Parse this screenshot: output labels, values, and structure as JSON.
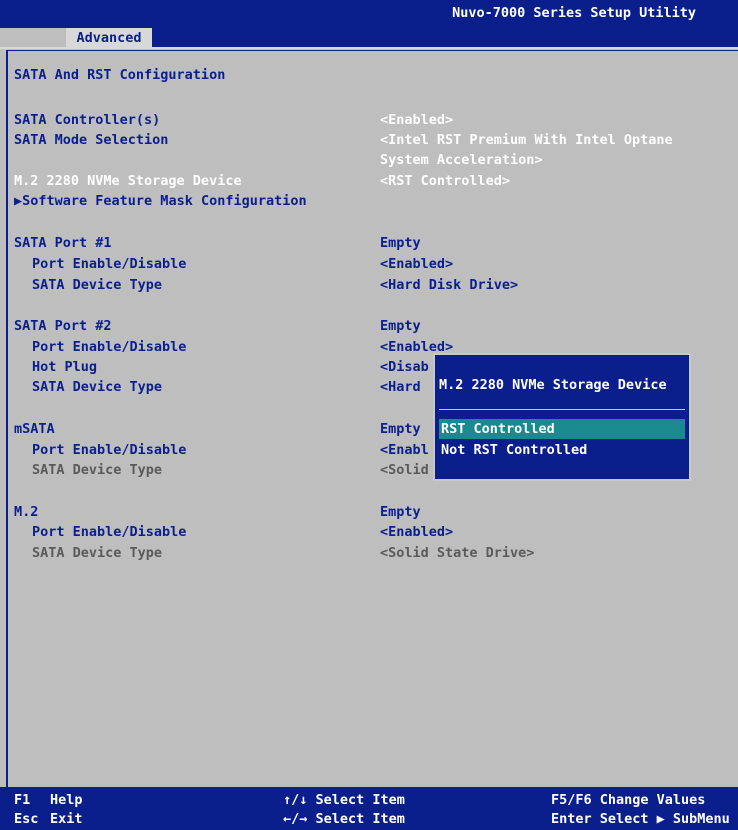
{
  "header": {
    "title": "Nuvo-7000 Series Setup Utility",
    "tab": "Advanced"
  },
  "section_title": "SATA And RST Configuration",
  "settings": {
    "sata_controllers": {
      "label": "SATA Controller(s)",
      "value": "<Enabled>"
    },
    "sata_mode": {
      "label": "SATA Mode Selection",
      "value_line1": "<Intel RST Premium With Intel Optane",
      "value_line2": "System Acceleration>"
    },
    "m2_nvme": {
      "label": "M.2 2280 NVMe Storage Device",
      "value": "<RST Controlled>"
    },
    "software_feature": {
      "label": "Software Feature Mask Configuration"
    }
  },
  "ports": {
    "p1": {
      "label": "SATA Port #1",
      "status": "Empty",
      "enable_label": "Port Enable/Disable",
      "enable_value": "<Enabled>",
      "type_label": "SATA Device Type",
      "type_value": "<Hard Disk Drive>"
    },
    "p2": {
      "label": "SATA Port #2",
      "status": "Empty",
      "enable_label": "Port Enable/Disable",
      "enable_value": "<Enabled>",
      "hotplug_label": "Hot Plug",
      "hotplug_value": "<Disab",
      "type_label": "SATA Device Type",
      "type_value": "<Hard"
    },
    "msata": {
      "label": "mSATA",
      "status": "Empty",
      "enable_label": "Port Enable/Disable",
      "enable_value": "<Enabl",
      "type_label": "SATA Device Type",
      "type_value": "<Solid"
    },
    "m2": {
      "label": "M.2",
      "status": "Empty",
      "enable_label": "Port Enable/Disable",
      "enable_value": "<Enabled>",
      "type_label": "SATA Device Type",
      "type_value": "<Solid State Drive>"
    }
  },
  "popup": {
    "title": "M.2 2280 NVMe Storage Device",
    "options": [
      "RST Controlled",
      "Not RST Controlled"
    ],
    "selected": "RST Controlled"
  },
  "footer": {
    "f1_key": "F1",
    "f1_label": "Help",
    "esc_key": "Esc",
    "esc_label": "Exit",
    "updown": "↑/↓ Select Item",
    "leftright": "←/→ Select Item",
    "f5f6": "F5/F6 Change Values",
    "enter": "Enter Select ▶ SubMenu"
  },
  "colors": {
    "bios_blue": "#0a1f8c",
    "panel_gray": "#bebebe",
    "highlight_teal": "#1a8a8f"
  }
}
